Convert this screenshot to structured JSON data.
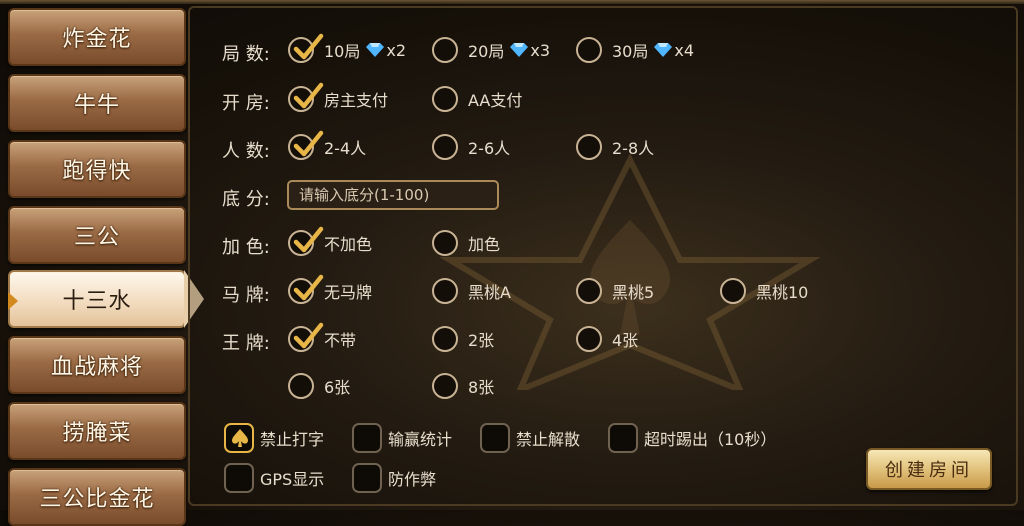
{
  "sidebar": {
    "items": [
      {
        "label": "炸金花"
      },
      {
        "label": "牛牛"
      },
      {
        "label": "跑得快"
      },
      {
        "label": "三公"
      },
      {
        "label": "十三水"
      },
      {
        "label": "血战麻将"
      },
      {
        "label": "捞腌菜"
      },
      {
        "label": "三公比金花"
      }
    ],
    "active_index": 4
  },
  "settings": {
    "rounds": {
      "label": "局 数:",
      "options": [
        {
          "text": "10局",
          "cost": "x2",
          "selected": true
        },
        {
          "text": "20局",
          "cost": "x3",
          "selected": false
        },
        {
          "text": "30局",
          "cost": "x4",
          "selected": false
        }
      ]
    },
    "room_pay": {
      "label": "开 房:",
      "options": [
        {
          "text": "房主支付",
          "selected": true
        },
        {
          "text": "AA支付",
          "selected": false
        }
      ]
    },
    "players": {
      "label": "人 数:",
      "options": [
        {
          "text": "2-4人",
          "selected": true
        },
        {
          "text": "2-6人",
          "selected": false
        },
        {
          "text": "2-8人",
          "selected": false
        }
      ]
    },
    "base_score": {
      "label": "底 分:",
      "placeholder": "请输入底分(1-100)",
      "value": ""
    },
    "add_color": {
      "label": "加 色:",
      "options": [
        {
          "text": "不加色",
          "selected": true
        },
        {
          "text": "加色",
          "selected": false
        }
      ]
    },
    "horse_card": {
      "label": "马 牌:",
      "options": [
        {
          "text": "无马牌",
          "selected": true
        },
        {
          "text": "黑桃A",
          "selected": false
        },
        {
          "text": "黑桃5",
          "selected": false
        },
        {
          "text": "黑桃10",
          "selected": false
        }
      ]
    },
    "king_card": {
      "label": "王 牌:",
      "options": [
        {
          "text": "不带",
          "selected": true
        },
        {
          "text": "2张",
          "selected": false
        },
        {
          "text": "4张",
          "selected": false
        },
        {
          "text": "6张",
          "selected": false
        },
        {
          "text": "8张",
          "selected": false
        }
      ]
    }
  },
  "checkboxes": [
    {
      "text": "禁止打字",
      "checked": true
    },
    {
      "text": "输赢统计",
      "checked": false
    },
    {
      "text": "禁止解散",
      "checked": false
    },
    {
      "text": "超时踢出（10秒）",
      "checked": false
    },
    {
      "text": "GPS显示",
      "checked": false
    },
    {
      "text": "防作弊",
      "checked": false
    }
  ],
  "create_button": {
    "label": "创建房间"
  },
  "icons": {
    "diamond": "diamond-icon",
    "check": "check-icon",
    "spade": "spade-icon"
  },
  "colors": {
    "accent_gold": "#e7b647",
    "text": "#e8ddcc",
    "panel_bg": "#1e160d"
  }
}
